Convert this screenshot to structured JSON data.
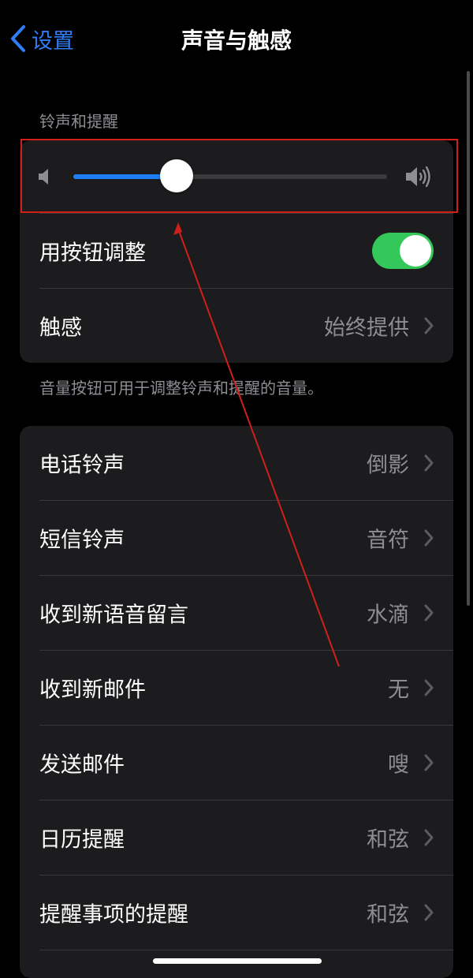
{
  "nav": {
    "back_label": "设置",
    "title": "声音与触感"
  },
  "ringtone_section": {
    "header": "铃声和提醒",
    "volume_slider": {
      "value_fraction": 0.33,
      "low_icon": "speaker-low-icon",
      "high_icon": "speaker-high-icon"
    },
    "change_with_buttons": {
      "label": "用按钮调整",
      "on": true
    },
    "haptics": {
      "label": "触感",
      "value": "始终提供"
    },
    "footer": "音量按钮可用于调整铃声和提醒的音量。"
  },
  "sounds": [
    {
      "label": "电话铃声",
      "value": "倒影"
    },
    {
      "label": "短信铃声",
      "value": "音符"
    },
    {
      "label": "收到新语音留言",
      "value": "水滴"
    },
    {
      "label": "收到新邮件",
      "value": "无"
    },
    {
      "label": "发送邮件",
      "value": "嗖"
    },
    {
      "label": "日历提醒",
      "value": "和弦"
    },
    {
      "label": "提醒事项的提醒",
      "value": "和弦"
    }
  ],
  "colors": {
    "accent": "#2f7df6",
    "toggle_on": "#34c759",
    "annotation": "#d0201a"
  }
}
